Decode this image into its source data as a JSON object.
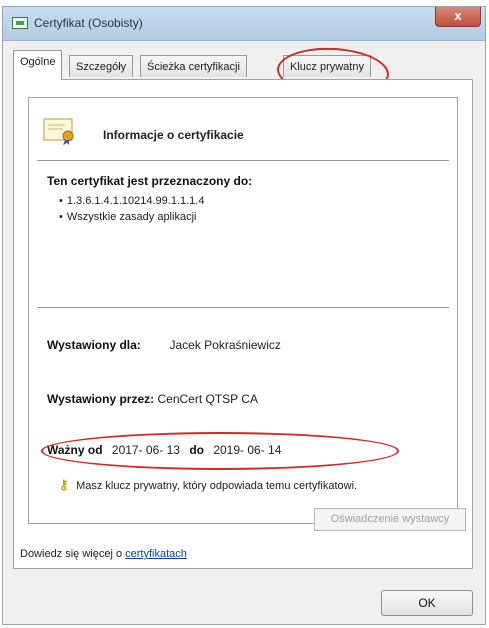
{
  "window": {
    "title": "Certyfikat (Osobisty)",
    "close_label": "x"
  },
  "tabs": [
    {
      "label": "Ogólne"
    },
    {
      "label": "Szczegóły"
    },
    {
      "label": "Ścieżka certyfikacji"
    },
    {
      "label": "Klucz prywatny"
    }
  ],
  "info": {
    "header": "Informacje o certyfikacie",
    "purpose_heading": "Ten certyfikat jest przeznaczony do:",
    "purposes": [
      "1.3.6.1.4.1.10214.99.1.1.1.4",
      "Wszystkie zasady aplikacji"
    ],
    "issued_to_label": "Wystawiony dla:",
    "issued_to_value": "Jacek Pokraśniewicz",
    "issued_by_label": "Wystawiony przez:",
    "issued_by_value": "CenCert QTSP CA",
    "valid_from_label": "Ważny od",
    "valid_from_value": "2017- 06- 13",
    "valid_to_label": "do",
    "valid_to_value": "2019- 06- 14",
    "private_key_note": "Masz klucz prywatny, który odpowiada temu certyfikatowi."
  },
  "buttons": {
    "issuer_statement": "Oświadczenie wystawcy",
    "ok": "OK"
  },
  "learn_more": {
    "prefix": "Dowiedz się więcej o ",
    "link": "certyfikatach"
  },
  "colors": {
    "annotation": "#d22a2a",
    "link": "#0645ad"
  }
}
